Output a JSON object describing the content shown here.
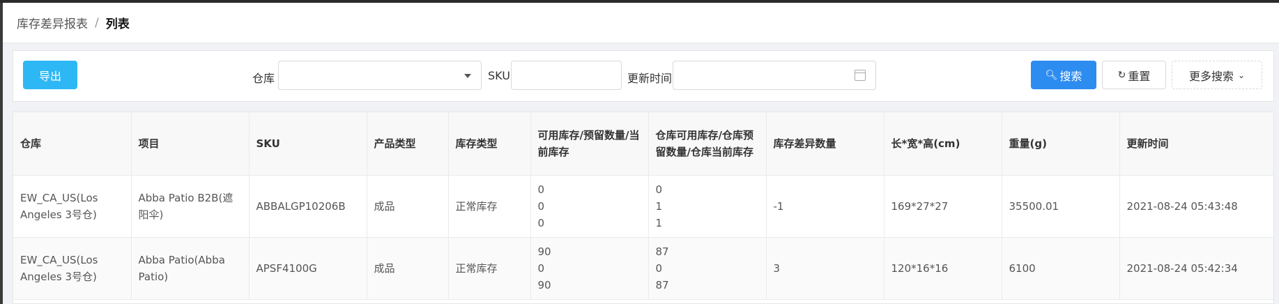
{
  "breadcrumb": {
    "parent": "库存差异报表",
    "separator": "/",
    "current": "列表"
  },
  "toolbar": {
    "export_label": "导出",
    "warehouse_label": "仓库",
    "warehouse_value": "",
    "sku_label": "SKU",
    "sku_value": "",
    "update_time_label": "更新时间",
    "update_time_value": "",
    "search_label": "搜索",
    "reset_label": "重置",
    "more_search_label": "更多搜索"
  },
  "table": {
    "columns": [
      "仓库",
      "项目",
      "SKU",
      "产品类型",
      "库存类型",
      "可用库存/预留数量/当前库存",
      "仓库可用库存/仓库预留数量/仓库当前库存",
      "库存差异数量",
      "长*宽*高(cm)",
      "重量(g)",
      "更新时间"
    ],
    "rows": [
      {
        "warehouse": "EW_CA_US(Los Angeles 3号仓)",
        "project": "Abba Patio B2B(遮阳伞)",
        "sku": "ABBALGP10206B",
        "product_type": "成品",
        "stock_type": "正常库存",
        "stock": [
          "0",
          "0",
          "0"
        ],
        "wh_stock": [
          "0",
          "1",
          "1"
        ],
        "diff": "-1",
        "dims": "169*27*27",
        "weight": "35500.01",
        "updated": "2021-08-24 05:43:48"
      },
      {
        "warehouse": "EW_CA_US(Los Angeles 3号仓)",
        "project": "Abba Patio(Abba Patio)",
        "sku": "APSF4100G",
        "product_type": "成品",
        "stock_type": "正常库存",
        "stock": [
          "90",
          "0",
          "90"
        ],
        "wh_stock": [
          "87",
          "0",
          "87"
        ],
        "diff": "3",
        "dims": "120*16*16",
        "weight": "6100",
        "updated": "2021-08-24 05:42:34"
      }
    ]
  },
  "colors": {
    "export": "#2db7f5",
    "primary": "#2d8cf0",
    "header_bg": "#f8f8f9"
  }
}
